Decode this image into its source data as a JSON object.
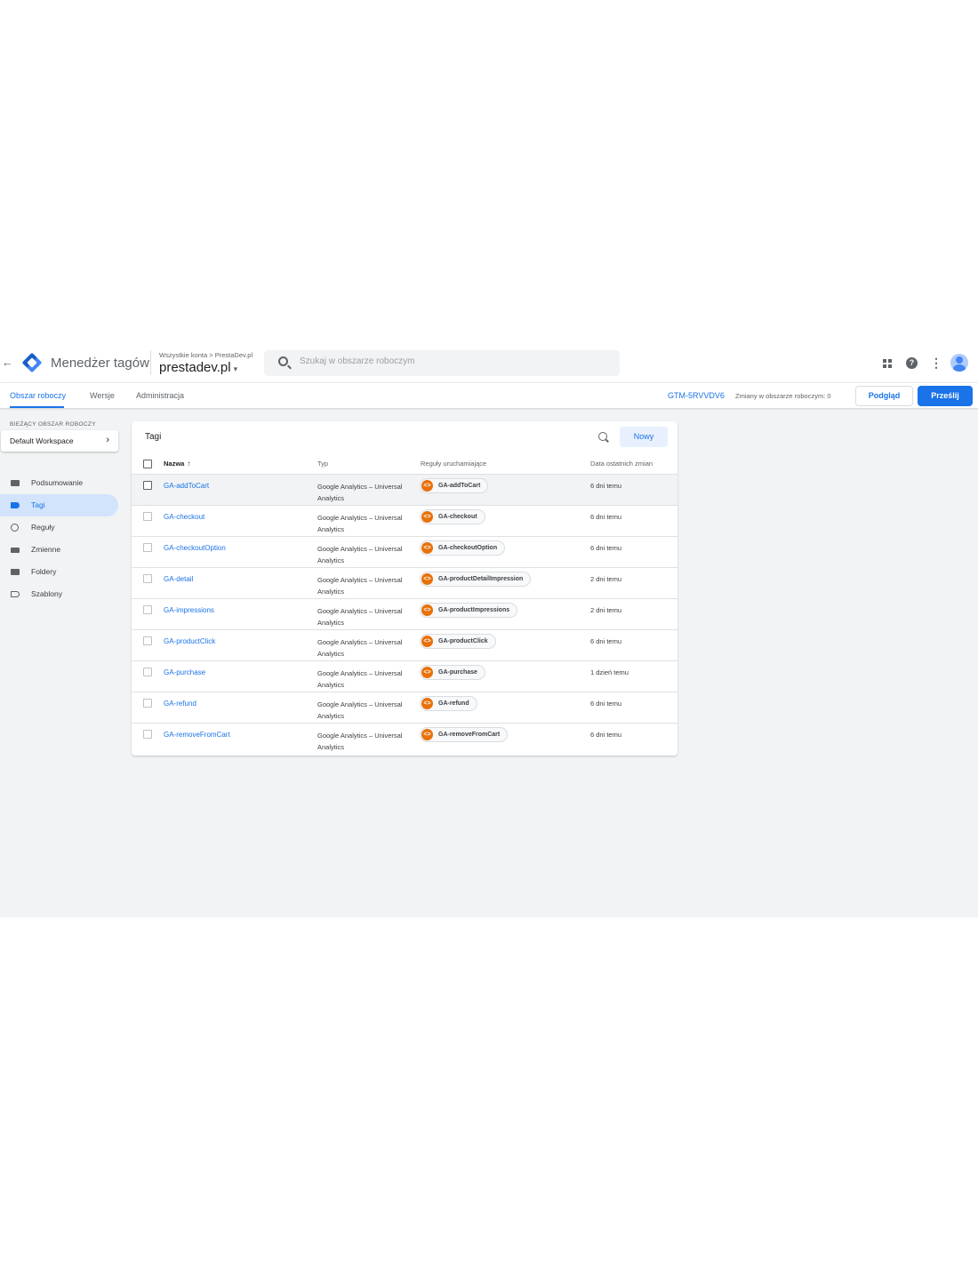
{
  "header": {
    "back_arrow": "←",
    "product_name": "Menedżer tagów",
    "breadcrumb": "Wszystkie konta > PrestaDev.pl",
    "container_name": "prestadev.pl",
    "caret": "▾",
    "search_placeholder": "Szukaj w obszarze roboczym",
    "help_glyph": "?",
    "more_glyph": "⋮"
  },
  "tabs": {
    "items": [
      {
        "label": "Obszar roboczy",
        "active": true
      },
      {
        "label": "Wersje",
        "active": false
      },
      {
        "label": "Administracja",
        "active": false
      }
    ],
    "container_id": "GTM-5RVVDV6",
    "changes": "Zmiany w obszarze roboczym: 0",
    "preview_label": "Podgląd",
    "submit_label": "Prześlij"
  },
  "sidebar": {
    "workspace_label": "BIEŻĄCY OBSZAR ROBOCZY",
    "workspace_name": "Default Workspace",
    "workspace_chevron": "›",
    "items": [
      {
        "label": "Podsumowanie",
        "icon": "briefcase-icon",
        "active": false
      },
      {
        "label": "Tagi",
        "icon": "tag-icon",
        "active": true
      },
      {
        "label": "Reguły",
        "icon": "trigger-icon",
        "active": false
      },
      {
        "label": "Zmienne",
        "icon": "variables-icon",
        "active": false
      },
      {
        "label": "Foldery",
        "icon": "folder-icon",
        "active": false
      },
      {
        "label": "Szablony",
        "icon": "template-icon",
        "active": false
      }
    ]
  },
  "table": {
    "title": "Tagi",
    "new_button": "Nowy",
    "columns": {
      "name": "Nazwa",
      "sort_glyph": "↑",
      "type": "Typ",
      "triggers": "Reguły uruchamiające",
      "date": "Data ostatnich zmian"
    },
    "rows": [
      {
        "name": "GA-addToCart",
        "type": "Google Analytics – Universal Analytics",
        "trigger": "GA-addToCart",
        "date": "6 dni temu"
      },
      {
        "name": "GA-checkout",
        "type": "Google Analytics – Universal Analytics",
        "trigger": "GA-checkout",
        "date": "6 dni temu"
      },
      {
        "name": "GA-checkoutOption",
        "type": "Google Analytics – Universal Analytics",
        "trigger": "GA-checkoutOption",
        "date": "6 dni temu"
      },
      {
        "name": "GA-detail",
        "type": "Google Analytics – Universal Analytics",
        "trigger": "GA-productDetailImpression",
        "date": "2 dni temu"
      },
      {
        "name": "GA-impressions",
        "type": "Google Analytics – Universal Analytics",
        "trigger": "GA-productImpressions",
        "date": "2 dni temu"
      },
      {
        "name": "GA-productClick",
        "type": "Google Analytics – Universal Analytics",
        "trigger": "GA-productClick",
        "date": "6 dni temu"
      },
      {
        "name": "GA-purchase",
        "type": "Google Analytics – Universal Analytics",
        "trigger": "GA-purchase",
        "date": "1 dzień temu"
      },
      {
        "name": "GA-refund",
        "type": "Google Analytics – Universal Analytics",
        "trigger": "GA-refund",
        "date": "6 dni temu"
      },
      {
        "name": "GA-removeFromCart",
        "type": "Google Analytics – Universal Analytics",
        "trigger": "GA-removeFromCart",
        "date": "6 dni temu"
      }
    ],
    "trigger_icon_glyph": "<>"
  },
  "colors": {
    "accent": "#1a73e8",
    "trigger_chip": "#e8710a",
    "background": "#f1f3f4"
  }
}
